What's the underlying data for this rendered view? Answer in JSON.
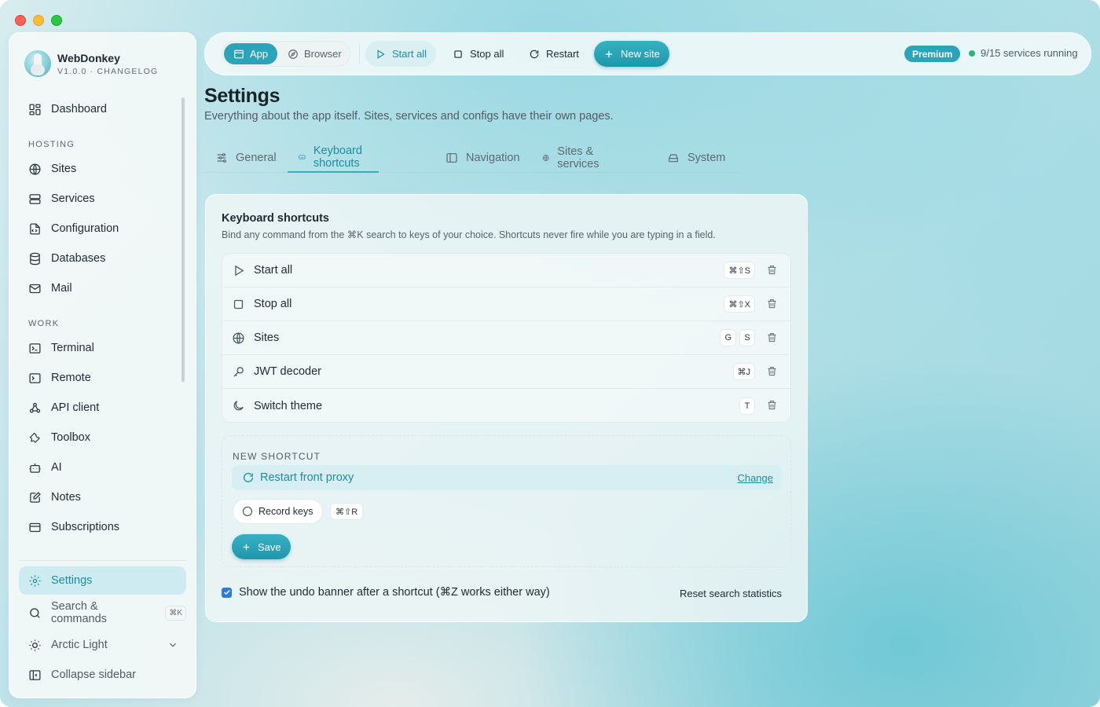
{
  "app": {
    "name": "WebDonkey",
    "version_line": "V1.0.0 · CHANGELOG"
  },
  "sidebar": {
    "top": [
      {
        "label": "Dashboard",
        "icon": "dashboard-icon"
      }
    ],
    "hosting_label": "HOSTING",
    "hosting": [
      {
        "label": "Sites",
        "icon": "globe-icon"
      },
      {
        "label": "Services",
        "icon": "server-icon"
      },
      {
        "label": "Configuration",
        "icon": "config-file-icon"
      },
      {
        "label": "Databases",
        "icon": "database-icon"
      },
      {
        "label": "Mail",
        "icon": "mail-icon"
      }
    ],
    "work_label": "WORK",
    "work": [
      {
        "label": "Terminal",
        "icon": "terminal-icon"
      },
      {
        "label": "Remote",
        "icon": "remote-icon"
      },
      {
        "label": "API client",
        "icon": "webhook-icon"
      },
      {
        "label": "Toolbox",
        "icon": "wrench-icon"
      },
      {
        "label": "AI",
        "icon": "robot-icon"
      },
      {
        "label": "Notes",
        "icon": "notes-icon"
      },
      {
        "label": "Subscriptions",
        "icon": "card-icon"
      }
    ],
    "settings_label": "Settings",
    "search_label": "Search & commands",
    "search_shortcut": "⌘K",
    "theme_label": "Arctic Light",
    "collapse_label": "Collapse sidebar"
  },
  "toolbar": {
    "mode_app": "App",
    "mode_browser": "Browser",
    "start_all": "Start all",
    "stop_all": "Stop all",
    "restart": "Restart",
    "new_site": "New site",
    "badge": "Premium",
    "status": "9/15 services running"
  },
  "page": {
    "title": "Settings",
    "subtitle": "Everything about the app itself. Sites, services and configs have their own pages."
  },
  "tabs": [
    {
      "label": "General",
      "icon": "sliders-icon"
    },
    {
      "label": "Keyboard shortcuts",
      "icon": "keyboard-icon"
    },
    {
      "label": "Navigation",
      "icon": "sidebar-layout-icon"
    },
    {
      "label": "Sites & services",
      "icon": "globe-icon"
    },
    {
      "label": "System",
      "icon": "hard-drive-icon"
    }
  ],
  "active_tab": "Keyboard shortcuts",
  "shortcuts_card": {
    "title": "Keyboard shortcuts",
    "description": "Bind any command from the ⌘K search to keys of your choice. Shortcuts never fire while you are typing in a field.",
    "rows": [
      {
        "name": "Start all",
        "icon": "play-icon",
        "keys": [
          "⌘⇧S"
        ]
      },
      {
        "name": "Stop all",
        "icon": "stop-icon",
        "keys": [
          "⌘⇧X"
        ]
      },
      {
        "name": "Sites",
        "icon": "globe-icon",
        "keys": [
          "G",
          "S"
        ]
      },
      {
        "name": "JWT decoder",
        "icon": "key-icon",
        "keys": [
          "⌘J"
        ]
      },
      {
        "name": "Switch theme",
        "icon": "moon-icon",
        "keys": [
          "T"
        ]
      }
    ],
    "new_label": "NEW SHORTCUT",
    "new_target": "Restart front proxy",
    "change_link": "Change",
    "record_label": "Record keys",
    "recorded_keys": "⌘⇧R",
    "save_label": "Save",
    "undo_text": "Show the undo banner after a shortcut (⌘Z works either way)",
    "undo_checked": true,
    "reset_label": "Reset search statistics"
  },
  "colors": {
    "accent": "#2aa4b8",
    "accent_text": "#1b8ea3",
    "status_green": "#2fb37a",
    "checkbox": "#2f7bd8"
  }
}
